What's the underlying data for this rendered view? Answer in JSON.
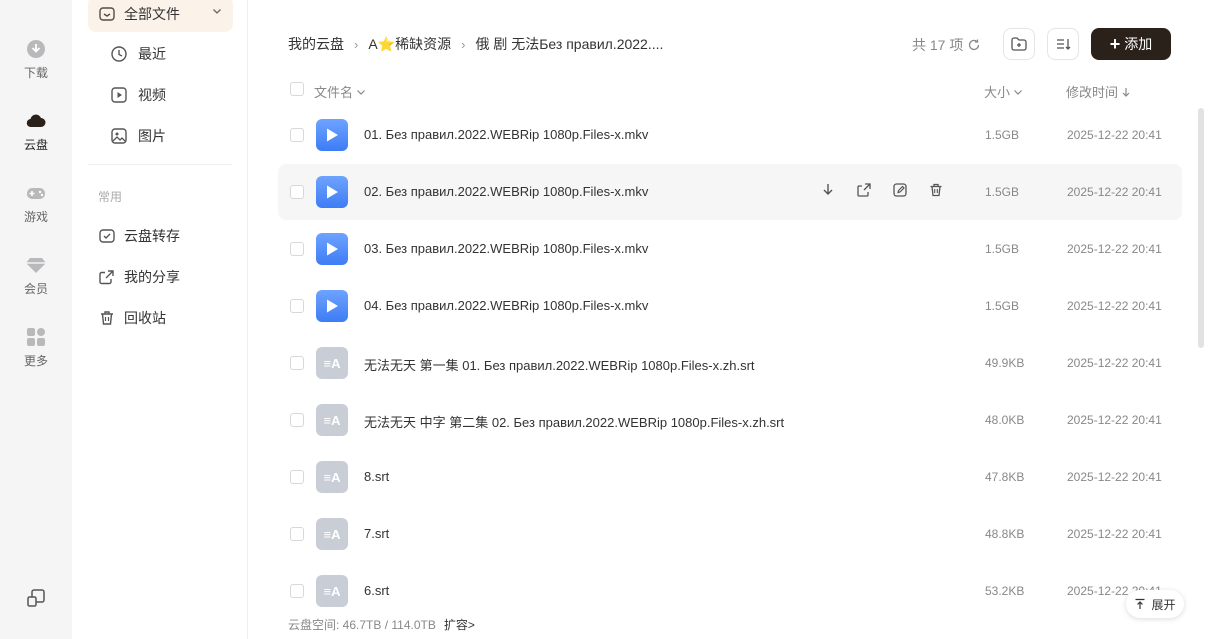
{
  "rail": {
    "items": [
      {
        "label": "下载",
        "icon": "download-icon"
      },
      {
        "label": "云盘",
        "icon": "cloud-icon",
        "active": true
      },
      {
        "label": "游戏",
        "icon": "gamepad-icon"
      },
      {
        "label": "会员",
        "icon": "diamond-icon"
      },
      {
        "label": "更多",
        "icon": "grid-icon"
      }
    ]
  },
  "sidebar": {
    "all_files": "全部文件",
    "recent": "最近",
    "video": "视频",
    "image": "图片",
    "group_label": "常用",
    "transfer": "云盘转存",
    "share": "我的分享",
    "trash": "回收站"
  },
  "breadcrumb": {
    "root": "我的云盘",
    "folder": "A⭐稀缺资源",
    "current": "俄 剧 无法Без правил.2022...."
  },
  "toolbar": {
    "count": "共 17 项",
    "add_label": "添加"
  },
  "table": {
    "col_name": "文件名",
    "col_size": "大小",
    "col_time": "修改时间",
    "rows": [
      {
        "name": "01. Без правил.2022.WEBRip 1080p.Files-x.mkv",
        "size": "1.5GB",
        "time": "2025-12-22 20:41",
        "type": "video"
      },
      {
        "name": "02. Без правил.2022.WEBRip 1080p.Files-x.mkv",
        "size": "1.5GB",
        "time": "2025-12-22 20:41",
        "type": "video"
      },
      {
        "name": "03. Без правил.2022.WEBRip 1080p.Files-x.mkv",
        "size": "1.5GB",
        "time": "2025-12-22 20:41",
        "type": "video"
      },
      {
        "name": "04. Без правил.2022.WEBRip 1080p.Files-x.mkv",
        "size": "1.5GB",
        "time": "2025-12-22 20:41",
        "type": "video"
      },
      {
        "name": "无法无天 第一集 01. Без правил.2022.WEBRip 1080p.Files-x.zh.srt",
        "size": "49.9KB",
        "time": "2025-12-22 20:41",
        "type": "subtitle"
      },
      {
        "name": "无法无天 中字 第二集 02. Без правил.2022.WEBRip 1080p.Files-x.zh.srt",
        "size": "48.0KB",
        "time": "2025-12-22 20:41",
        "type": "subtitle"
      },
      {
        "name": "8.srt",
        "size": "47.8KB",
        "time": "2025-12-22 20:41",
        "type": "subtitle"
      },
      {
        "name": "7.srt",
        "size": "48.8KB",
        "time": "2025-12-22 20:41",
        "type": "subtitle"
      },
      {
        "name": "6.srt",
        "size": "53.2KB",
        "time": "2025-12-22 20:41",
        "type": "subtitle"
      }
    ]
  },
  "footer": {
    "storage": "云盘空间: 46.7TB / 114.0TB",
    "expand_link": "扩容>"
  },
  "expand_button": "展开",
  "subtitle_icon_glyph": "≡A"
}
